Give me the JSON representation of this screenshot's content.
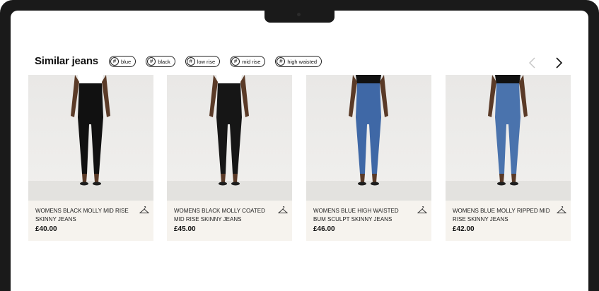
{
  "section": {
    "title": "Similar jeans",
    "tags": [
      "blue",
      "black",
      "low rise",
      "mid rise",
      "high waisted"
    ],
    "hash_symbol": "#"
  },
  "carousel": {
    "prev_icon": "chevron-left-icon",
    "next_icon": "chevron-right-icon"
  },
  "products": [
    {
      "name": "WOMENS BLACK MOLLY MID RISE SKINNY JEANS",
      "price": "£40.00",
      "color": "#111111",
      "top": "#ffffff"
    },
    {
      "name": "WOMENS BLACK MOLLY COATED MID RISE SKINNY JEANS",
      "price": "£45.00",
      "color": "#161616",
      "top": "#ffffff"
    },
    {
      "name": "WOMENS BLUE HIGH WAISTED BUM SCULPT SKINNY JEANS",
      "price": "£46.00",
      "color": "#3f68a6",
      "top": "#111111"
    },
    {
      "name": "WOMENS BLUE MOLLY RIPPED MID RISE SKINNY JEANS",
      "price": "£42.00",
      "color": "#4a73ad",
      "top": "#111111"
    }
  ],
  "colors": {
    "skin": "#5a3a27",
    "card_bg": "#f6f3ee",
    "frame": "#1a1a1a"
  }
}
